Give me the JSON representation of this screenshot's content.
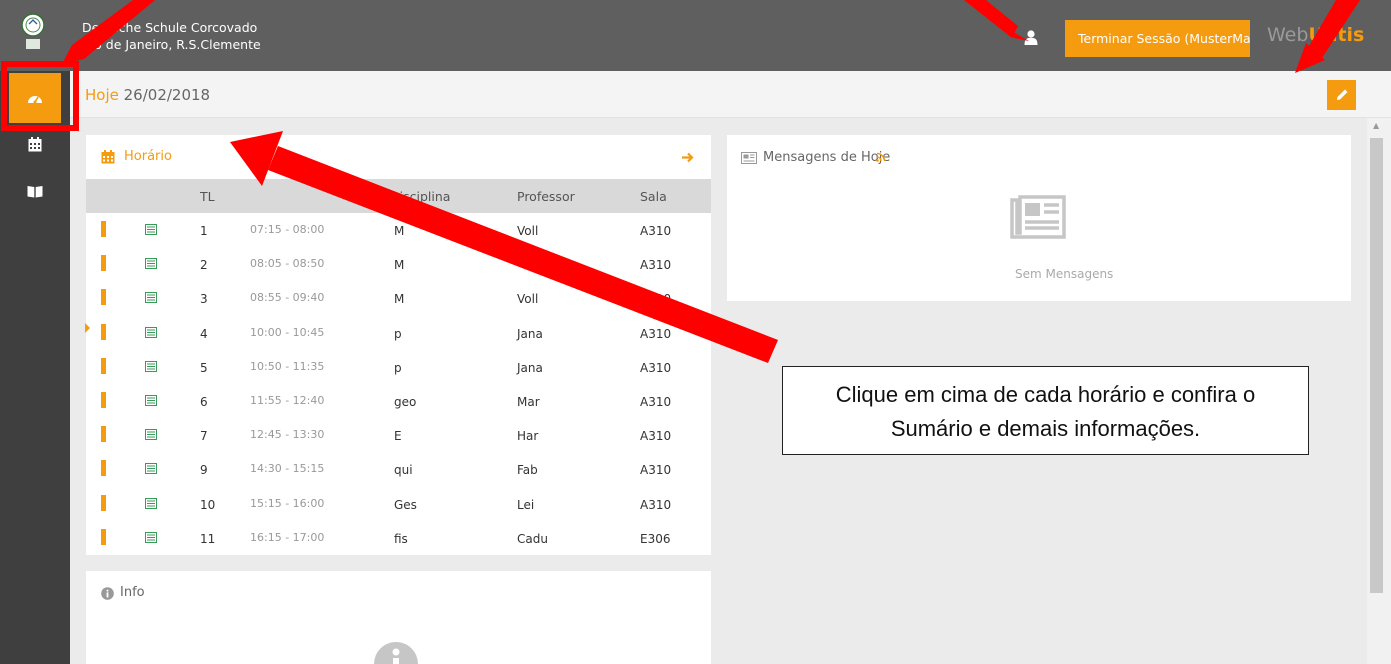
{
  "header": {
    "school_name": "Deutsche Schule Corcovado",
    "school_location": "Rio de Janeiro, R.S.Clemente",
    "logout_label": "Terminar Sessão (MusterMan)",
    "brand_prefix": "Web",
    "brand_suffix": "Untis"
  },
  "subheader": {
    "today_label": "Hoje",
    "date": "26/02/2018"
  },
  "timetable": {
    "title": "Horário",
    "columns": [
      "TL",
      "",
      "Disciplina",
      "Professor",
      "Sala"
    ],
    "rows": [
      {
        "tl": "1",
        "time": "07:15 - 08:00",
        "subject": "M",
        "teacher": "Voll",
        "room": "A310"
      },
      {
        "tl": "2",
        "time": "08:05 - 08:50",
        "subject": "M",
        "teacher": "",
        "room": "A310"
      },
      {
        "tl": "3",
        "time": "08:55 - 09:40",
        "subject": "M",
        "teacher": "Voll",
        "room": "A310"
      },
      {
        "tl": "4",
        "time": "10:00 - 10:45",
        "subject": "p",
        "teacher": "Jana",
        "room": "A310"
      },
      {
        "tl": "5",
        "time": "10:50 - 11:35",
        "subject": "p",
        "teacher": "Jana",
        "room": "A310"
      },
      {
        "tl": "6",
        "time": "11:55 - 12:40",
        "subject": "geo",
        "teacher": "Mar",
        "room": "A310"
      },
      {
        "tl": "7",
        "time": "12:45 - 13:30",
        "subject": "E",
        "teacher": "Har",
        "room": "A310"
      },
      {
        "tl": "9",
        "time": "14:30 - 15:15",
        "subject": "qui",
        "teacher": "Fab",
        "room": "A310"
      },
      {
        "tl": "10",
        "time": "15:15 - 16:00",
        "subject": "Ges",
        "teacher": "Lei",
        "room": "A310"
      },
      {
        "tl": "11",
        "time": "16:15 - 17:00",
        "subject": "fis",
        "teacher": "Cadu",
        "room": "E306"
      }
    ]
  },
  "messages": {
    "title": "Mensagens de Hoje",
    "empty_text": "Sem Mensagens"
  },
  "info": {
    "title": "Info"
  },
  "callout": {
    "line1": "Clique em cima de cada horário e confira o",
    "line2": "Sumário e demais informações."
  },
  "colors": {
    "accent": "#f49b10",
    "topbar": "#5f5f5f",
    "sidebar": "#3f3f3f",
    "annotation": "#ff0000"
  },
  "icons": [
    "school-logo-icon",
    "user-icon",
    "dashboard-icon",
    "calendar-icon",
    "book-icon",
    "pencil-icon",
    "calendar-icon",
    "arrow-right-icon",
    "newspaper-icon",
    "rss-icon",
    "info-icon",
    "lesson-icon"
  ]
}
